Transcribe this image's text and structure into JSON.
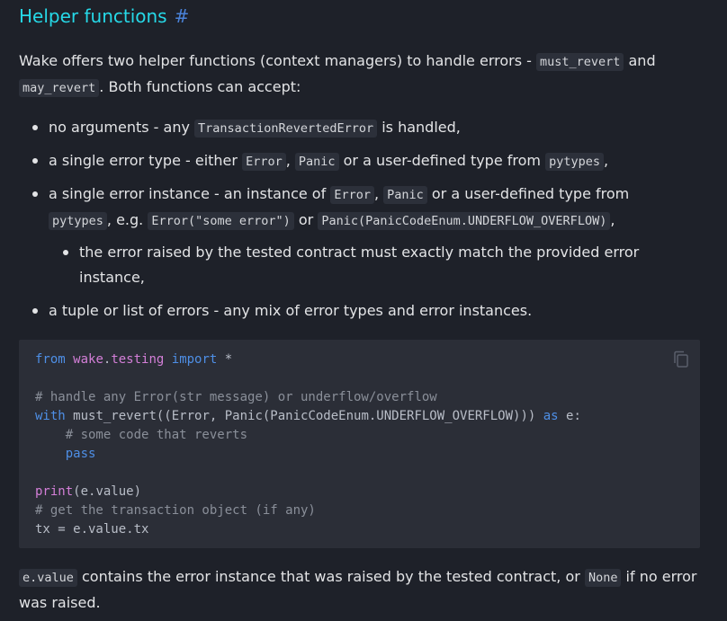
{
  "heading": {
    "title": "Helper functions",
    "anchor": "#"
  },
  "intro": {
    "t1": "Wake offers two helper functions (context managers) to handle errors -",
    "c1": "must_revert",
    "t2": "and",
    "c2": "may_revert",
    "t3": ". Both functions can accept:"
  },
  "bullets": {
    "b1": {
      "t1": "no arguments - any",
      "c1": "TransactionRevertedError",
      "t2": "is handled,"
    },
    "b2": {
      "t1": "a single error type - either",
      "c1": "Error",
      "t2": ",",
      "c2": "Panic",
      "t3": "or a user-defined type from",
      "c3": "pytypes",
      "t4": ","
    },
    "b3": {
      "t1": "a single error instance - an instance of",
      "c1": "Error",
      "t2": ",",
      "c2": "Panic",
      "t3": "or a user-defined type from",
      "c3": "pytypes",
      "t4": ", e.g.",
      "c4": "Error(\"some error\")",
      "t5": "or",
      "c5": "Panic(PanicCodeEnum.UNDERFLOW_OVERFLOW)",
      "t6": ","
    },
    "b3sub": {
      "t1": "the error raised by the tested contract must exactly match the provided error instance,"
    },
    "b4": {
      "t1": "a tuple or list of errors - any mix of error types and error instances."
    }
  },
  "code": {
    "l1_from": "from",
    "l1_mod": "wake",
    "l1_dot": ".",
    "l1_mod2": "testing",
    "l1_import": "import",
    "l1_star": "*",
    "l3": "# handle any Error(str message) or underflow/overflow",
    "l4_with": "with",
    "l4_body": "must_revert((Error, Panic(PanicCodeEnum.UNDERFLOW_OVERFLOW)))",
    "l4_as": "as",
    "l4_e": "e:",
    "l5": "# some code that reverts",
    "l6": "pass",
    "l8_print": "print",
    "l8_rest": "(e.value)",
    "l9": "# get the transaction object (if any)",
    "l10": "tx = e.value.tx"
  },
  "outro": {
    "c1": "e.value",
    "t1": "contains the error instance that was raised by the tested contract, or",
    "c2": "None",
    "t2": "if no error was raised."
  },
  "icons": {
    "copy": "copy-icon"
  },
  "colors": {
    "heading": "#26d9e8",
    "anchor": "#4a82d8",
    "keyword": "#4e8fe6",
    "module": "#d47fd8",
    "comment": "#8a8f99",
    "background": "#1e2129"
  }
}
